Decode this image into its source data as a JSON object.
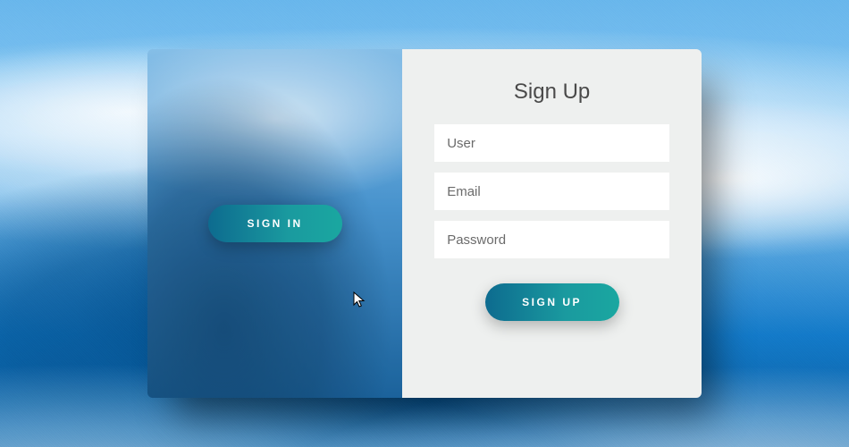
{
  "left": {
    "signin_label": "SIGN IN"
  },
  "form": {
    "title": "Sign Up",
    "user_placeholder": "User",
    "email_placeholder": "Email",
    "password_placeholder": "Password",
    "submit_label": "SIGN UP"
  },
  "colors": {
    "accent_gradient_start": "#0d6b8f",
    "accent_gradient_end": "#1aa7a0",
    "panel_bg": "#eef0ef"
  }
}
